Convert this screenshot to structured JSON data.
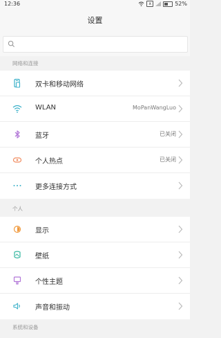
{
  "status": {
    "time": "12:36",
    "battery": "52%",
    "sim": "x"
  },
  "title": "设置",
  "search": {
    "placeholder": ""
  },
  "sections": [
    {
      "header": "网络和连接",
      "items": [
        {
          "label": "双卡和移动网络",
          "value": "",
          "icon": "dual-sim-icon",
          "color": "#3ab0c9"
        },
        {
          "label": "WLAN",
          "value": "MoPanWangLuo",
          "icon": "wifi-icon",
          "color": "#3ab0c9"
        },
        {
          "label": "蓝牙",
          "value": "已关闭",
          "icon": "bluetooth-icon",
          "color": "#b277d8"
        },
        {
          "label": "个人热点",
          "value": "已关闭",
          "icon": "hotspot-icon",
          "color": "#f08a5d"
        },
        {
          "label": "更多连接方式",
          "value": "",
          "icon": "more-dots-icon",
          "color": "#3ab0c9"
        }
      ]
    },
    {
      "header": "个人",
      "items": [
        {
          "label": "显示",
          "value": "",
          "icon": "display-icon",
          "color": "#f09a3e"
        },
        {
          "label": "壁纸",
          "value": "",
          "icon": "wallpaper-icon",
          "color": "#35b7a0"
        },
        {
          "label": "个性主题",
          "value": "",
          "icon": "theme-icon",
          "color": "#b277d8"
        },
        {
          "label": "声音和振动",
          "value": "",
          "icon": "sound-icon",
          "color": "#3ab0c9"
        }
      ]
    },
    {
      "header": "系统和设备",
      "items": []
    }
  ]
}
